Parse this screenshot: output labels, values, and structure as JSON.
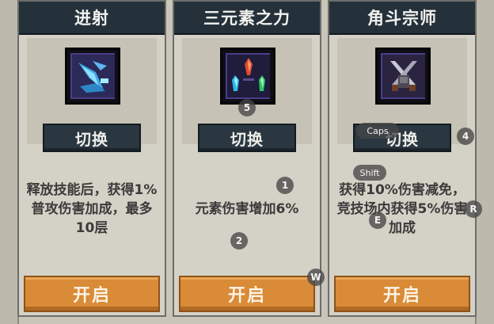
{
  "cards": [
    {
      "title": "进射",
      "icon": "blue-arrow-shard-icon",
      "switch_label": "切换",
      "description": "释放技能后，获得1%普攻伤害加成，最多10层",
      "open_label": "开启"
    },
    {
      "title": "三元素之力",
      "icon": "three-crystals-icon",
      "switch_label": "切换",
      "description": "元素伤害增加6%",
      "open_label": "开启"
    },
    {
      "title": "角斗宗师",
      "icon": "crossed-swords-icon",
      "switch_label": "切换",
      "description": "获得10%伤害减免，竞技场内获得5%伤害加成",
      "open_label": "开启"
    }
  ],
  "key_hints": {
    "five": "5",
    "one": "1",
    "two": "2",
    "four": "4",
    "w": "W",
    "r": "R",
    "caps": "Caps",
    "shift": "Shift",
    "e": "E"
  },
  "colors": {
    "title_bar": "#25313a",
    "switch_button": "#2a3741",
    "open_button": "#d98b37",
    "card_bg": "#d4d1c6"
  }
}
